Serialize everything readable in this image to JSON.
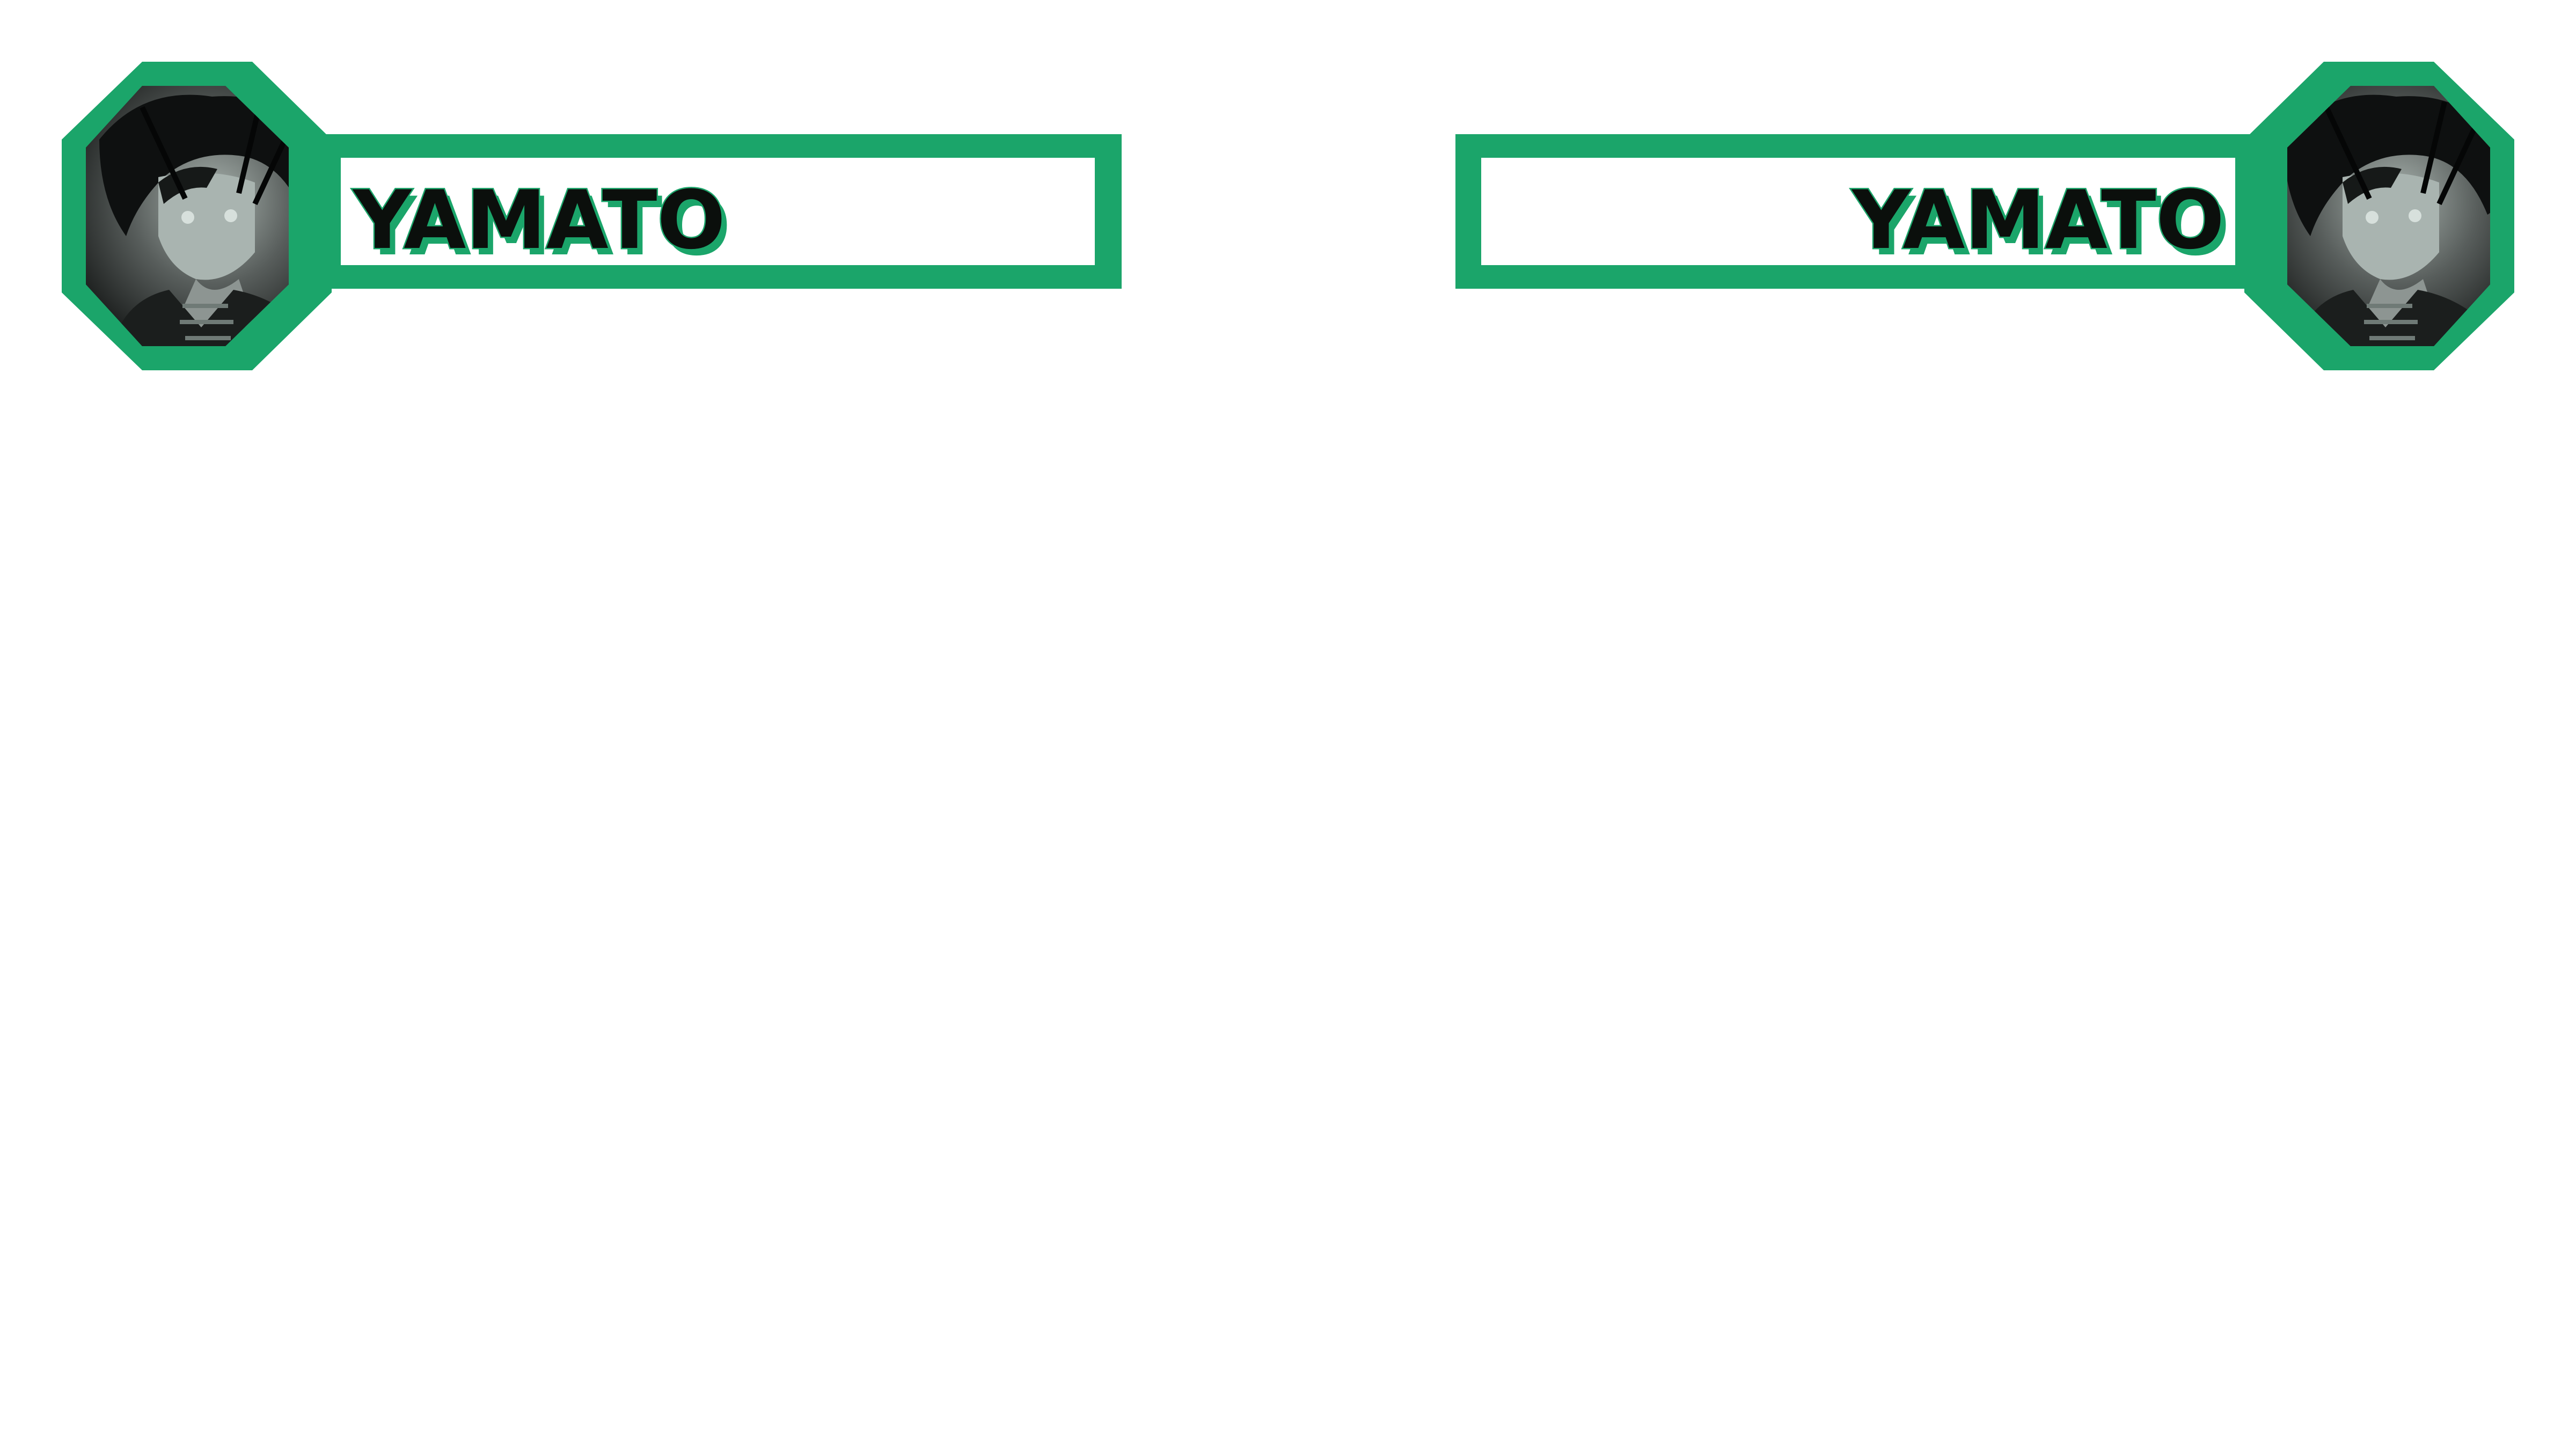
{
  "colors": {
    "accent": "#1ba56a",
    "name_fill": "#0b0f0c",
    "background": "#ffffff"
  },
  "player_left": {
    "name": "YAMATO",
    "portrait_icon": "character-portrait-icon"
  },
  "player_right": {
    "name": "YAMATO",
    "portrait_icon": "character-portrait-icon"
  }
}
